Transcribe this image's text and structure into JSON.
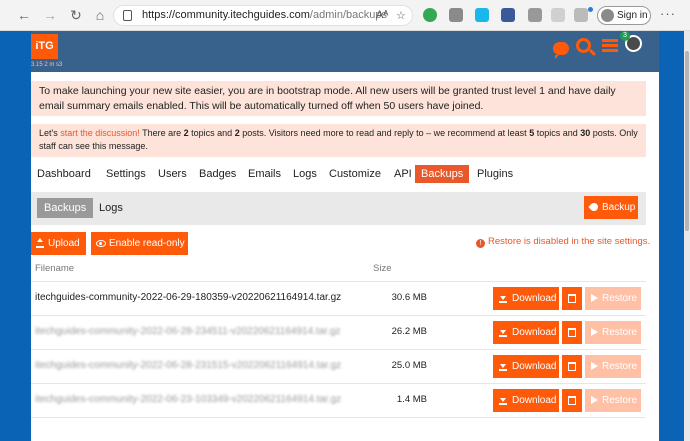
{
  "browser": {
    "url_host": "https://community.itechguides.com",
    "url_path": "/admin/backups",
    "sign_in_label": "Sign in",
    "read_aloud": "Aᴬ"
  },
  "header": {
    "logo_text": "iTG",
    "perf_text": "3.15   2 m   s3",
    "notification_count": "3"
  },
  "alerts": {
    "bootstrap": "To make launching your new site easier, you are in bootstrap mode. All new users will be granted trust level 1 and have daily email summary emails enabled. This will be automatically turned off when 50 users have joined.",
    "discussion_prefix": "Let's ",
    "discussion_link": "start the discussion!",
    "discussion_mid1": " There are ",
    "topics_count": "2",
    "discussion_mid2": " topics and ",
    "posts_count": "2",
    "discussion_mid3": " posts. Visitors need more to read and reply to – we recommend at least ",
    "rec_topics": "5",
    "discussion_mid4": " topics and ",
    "rec_posts": "30",
    "discussion_suffix": " posts. Only staff can see this message."
  },
  "tabs": [
    "Dashboard",
    "Settings",
    "Users",
    "Badges",
    "Emails",
    "Logs",
    "Customize",
    "API",
    "Backups",
    "Plugins"
  ],
  "subnav": {
    "active": "Backups",
    "logs": "Logs",
    "backup_button": "Backup"
  },
  "actions": {
    "upload": "Upload",
    "enable_readonly": "Enable read-only",
    "restore_notice": "Restore is disabled in the site settings."
  },
  "table": {
    "col_filename": "Filename",
    "col_size": "Size",
    "download_label": "Download",
    "restore_label": "Restore",
    "rows": [
      {
        "filename": "itechguides-community-2022-06-29-180359-v20220621164914.tar.gz",
        "size": "30.6 MB"
      },
      {
        "filename": "itechguides-community-2022-06-28-234511-v20220621164914.tar.gz",
        "size": "26.2 MB"
      },
      {
        "filename": "itechguides-community-2022-06-28-231515-v20220621164914.tar.gz",
        "size": "25.0 MB"
      },
      {
        "filename": "itechguides-community-2022-06-23-103349-v20220621164914.tar.gz",
        "size": "1.4 MB"
      }
    ]
  },
  "colors": {
    "accent": "#ff5a0a",
    "header": "#38628b",
    "alert_bg": "#fde3d9"
  }
}
